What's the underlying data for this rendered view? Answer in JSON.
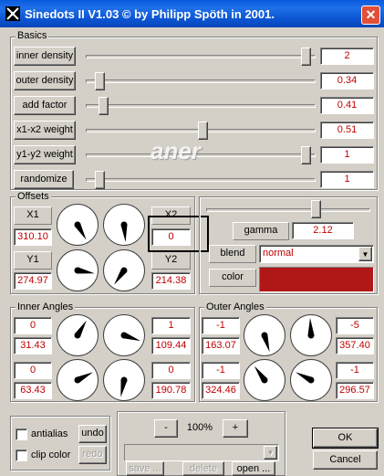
{
  "window": {
    "title": "Sinedots II V1.03 © by Philipp Spöth in 2001."
  },
  "basics": {
    "label": "Basics",
    "rows": [
      {
        "label": "inner density",
        "value": "2",
        "level": 0.98
      },
      {
        "label": "outer density",
        "value": "0.34",
        "level": 0.04
      },
      {
        "label": "add factor",
        "value": "0.41",
        "level": 0.06
      },
      {
        "label": "x1-x2 weight",
        "value": "0.51",
        "level": 0.51
      },
      {
        "label": "y1-y2 weight",
        "value": "1",
        "level": 0.98
      },
      {
        "label": "randomize",
        "value": "1",
        "level": 0.04
      }
    ]
  },
  "offsets": {
    "label": "Offsets",
    "x1_label": "X1",
    "x1_value": "310.10",
    "y1_label": "Y1",
    "y1_value": "274.97",
    "x2_label": "X2",
    "x2_value": "0",
    "y2_label": "Y2",
    "y2_value": "214.38"
  },
  "gamma": {
    "label": "gamma",
    "value": "2.12",
    "level": 0.68
  },
  "blend": {
    "label": "blend",
    "value": "normal"
  },
  "color": {
    "label": "color",
    "swatch": "#b01818"
  },
  "inner_angles": {
    "label": "Inner Angles",
    "a_top": "0",
    "a_val": "31.43",
    "b_top": "1",
    "b_val": "109.44",
    "c_top": "0",
    "c_val": "63.43",
    "d_top": "0",
    "d_val": "190.78"
  },
  "outer_angles": {
    "label": "Outer Angles",
    "a_top": "-1",
    "a_val": "163.07",
    "b_top": "-5",
    "b_val": "357.40",
    "c_top": "-1",
    "c_val": "324.46",
    "d_top": "-1",
    "d_val": "296.57"
  },
  "options": {
    "antialias": "antialias",
    "clip_color": "clip color",
    "undo": "undo",
    "redo": "redo"
  },
  "presets": {
    "minus": "-",
    "zoom": "100%",
    "plus": "+",
    "save": "save ...",
    "delete": "delete",
    "open": "open ..."
  },
  "dialog": {
    "ok": "OK",
    "cancel": "Cancel"
  },
  "watermark": "aner"
}
